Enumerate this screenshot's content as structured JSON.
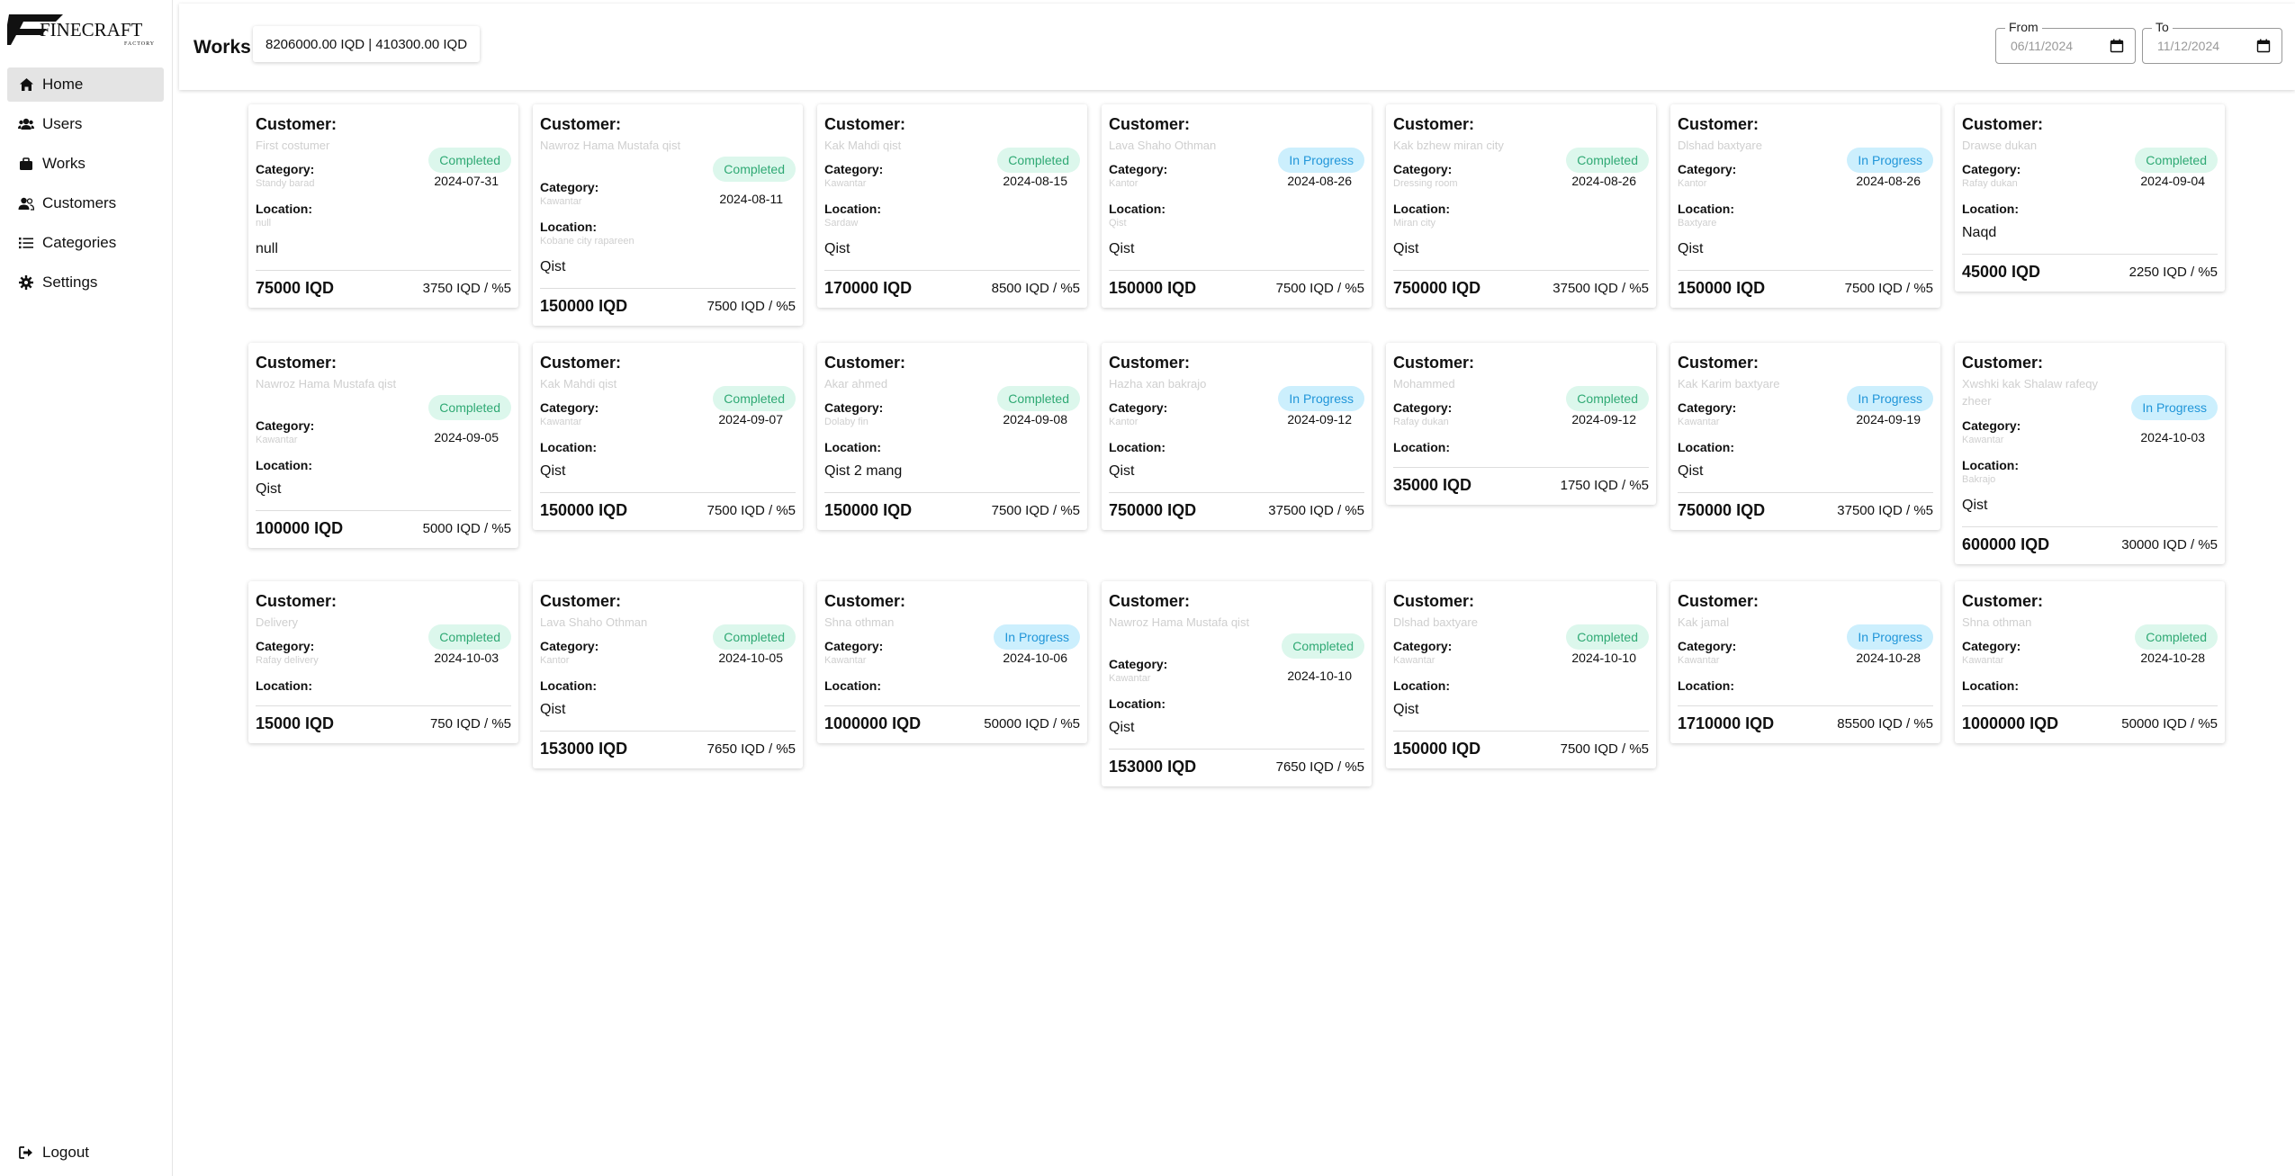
{
  "app": {
    "logo_text": "FINECRAFT",
    "logo_sub": "FACTORY"
  },
  "sidebar": {
    "items": [
      {
        "label": "Home",
        "icon": "home-icon",
        "active": true
      },
      {
        "label": "Users",
        "icon": "users-icon"
      },
      {
        "label": "Works",
        "icon": "briefcase-icon"
      },
      {
        "label": "Customers",
        "icon": "user-group-icon"
      },
      {
        "label": "Categories",
        "icon": "list-icon"
      },
      {
        "label": "Settings",
        "icon": "gear-icon"
      }
    ],
    "logout_label": "Logout"
  },
  "header": {
    "title": "Works",
    "totals": "8206000.00 IQD | 410300.00 IQD",
    "from_label": "From",
    "from_value": "06/11/2024",
    "to_label": "To",
    "to_value": "11/12/2024"
  },
  "card_labels": {
    "customer": "Customer:",
    "category": "Category:",
    "location": "Location:"
  },
  "status_colors": {
    "completed_bg": "#dcf7ec",
    "completed_text": "#2fa974",
    "in_progress_bg": "#cceffd",
    "in_progress_text": "#2196d9"
  },
  "works": [
    {
      "customer": "First costumer",
      "status": "Completed",
      "category": "Standy barad",
      "date": "2024-07-31",
      "location": "null",
      "payment": "null",
      "price": "75000 IQD",
      "commission": "3750 IQD / %5"
    },
    {
      "customer": "Nawroz Hama Mustafa qist",
      "status": "Completed",
      "category": "Kawantar",
      "date": "2024-08-11",
      "location": "Kobane city rapareen",
      "payment": "Qist",
      "price": "150000 IQD",
      "commission": "7500 IQD / %5"
    },
    {
      "customer": "Kak Mahdi qist",
      "status": "Completed",
      "category": "Kawantar",
      "date": "2024-08-15",
      "location": "Sardaw",
      "payment": "Qist",
      "price": "170000 IQD",
      "commission": "8500 IQD / %5"
    },
    {
      "customer": "Lava Shaho Othman",
      "status": "In Progress",
      "category": "Kantor",
      "date": "2024-08-26",
      "location": "Qist",
      "payment": "Qist",
      "price": "150000 IQD",
      "commission": "7500 IQD / %5"
    },
    {
      "customer": "Kak bzhew miran city",
      "status": "Completed",
      "category": "Dressing room",
      "date": "2024-08-26",
      "location": "Miran city",
      "payment": "Qist",
      "price": "750000 IQD",
      "commission": "37500 IQD / %5"
    },
    {
      "customer": "Dlshad baxtyare",
      "status": "In Progress",
      "category": "Kantor",
      "date": "2024-08-26",
      "location": "Baxtyare",
      "payment": "Qist",
      "price": "150000 IQD",
      "commission": "7500 IQD / %5"
    },
    {
      "customer": "Drawse dukan",
      "status": "Completed",
      "category": "Rafay dukan",
      "date": "2024-09-04",
      "location": "",
      "payment": "Naqd",
      "price": "45000 IQD",
      "commission": "2250 IQD / %5"
    },
    {
      "customer": "Nawroz Hama Mustafa qist",
      "status": "Completed",
      "category": "Kawantar",
      "date": "2024-09-05",
      "location": "",
      "payment": "Qist",
      "price": "100000 IQD",
      "commission": "5000 IQD / %5"
    },
    {
      "customer": "Kak Mahdi qist",
      "status": "Completed",
      "category": "Kawantar",
      "date": "2024-09-07",
      "location": "",
      "payment": "Qist",
      "price": "150000 IQD",
      "commission": "7500 IQD / %5"
    },
    {
      "customer": "Akar ahmed",
      "status": "Completed",
      "category": "Dolaby fin",
      "date": "2024-09-08",
      "location": "",
      "payment": "Qist 2 mang",
      "price": "150000 IQD",
      "commission": "7500 IQD / %5"
    },
    {
      "customer": "Hazha xan bakrajo",
      "status": "In Progress",
      "category": "Kantor",
      "date": "2024-09-12",
      "location": "",
      "payment": "Qist",
      "price": "750000 IQD",
      "commission": "37500 IQD / %5"
    },
    {
      "customer": "Mohammed",
      "status": "Completed",
      "category": "Rafay dukan",
      "date": "2024-09-12",
      "location": "",
      "payment": "",
      "price": "35000 IQD",
      "commission": "1750 IQD / %5"
    },
    {
      "customer": "Kak Karim baxtyare",
      "status": "In Progress",
      "category": "Kawantar",
      "date": "2024-09-19",
      "location": "",
      "payment": "Qist",
      "price": "750000 IQD",
      "commission": "37500 IQD / %5"
    },
    {
      "customer": "Xwshki kak Shalaw rafeqy zheer",
      "status": "In Progress",
      "category": "Kawantar",
      "date": "2024-10-03",
      "location": "Bakrajo",
      "payment": "Qist",
      "price": "600000 IQD",
      "commission": "30000 IQD / %5"
    },
    {
      "customer": "Delivery",
      "status": "Completed",
      "category": "Rafay delivery",
      "date": "2024-10-03",
      "location": "",
      "payment": "",
      "price": "15000 IQD",
      "commission": "750 IQD / %5"
    },
    {
      "customer": "Lava Shaho Othman",
      "status": "Completed",
      "category": "Kantor",
      "date": "2024-10-05",
      "location": "",
      "payment": "Qist",
      "price": "153000 IQD",
      "commission": "7650 IQD / %5"
    },
    {
      "customer": "Shna othman",
      "status": "In Progress",
      "category": "Kawantar",
      "date": "2024-10-06",
      "location": "",
      "payment": "",
      "price": "1000000 IQD",
      "commission": "50000 IQD / %5"
    },
    {
      "customer": "Nawroz Hama Mustafa qist",
      "status": "Completed",
      "category": "Kawantar",
      "date": "2024-10-10",
      "location": "",
      "payment": "Qist",
      "price": "153000 IQD",
      "commission": "7650 IQD / %5"
    },
    {
      "customer": "Dlshad baxtyare",
      "status": "Completed",
      "category": "Kawantar",
      "date": "2024-10-10",
      "location": "",
      "payment": "Qist",
      "price": "150000 IQD",
      "commission": "7500 IQD / %5"
    },
    {
      "customer": "Kak jamal",
      "status": "In Progress",
      "category": "Kawantar",
      "date": "2024-10-28",
      "location": "",
      "payment": "",
      "price": "1710000 IQD",
      "commission": "85500 IQD / %5"
    },
    {
      "customer": "Shna othman",
      "status": "Completed",
      "category": "Kawantar",
      "date": "2024-10-28",
      "location": "",
      "payment": "",
      "price": "1000000 IQD",
      "commission": "50000 IQD / %5"
    }
  ]
}
